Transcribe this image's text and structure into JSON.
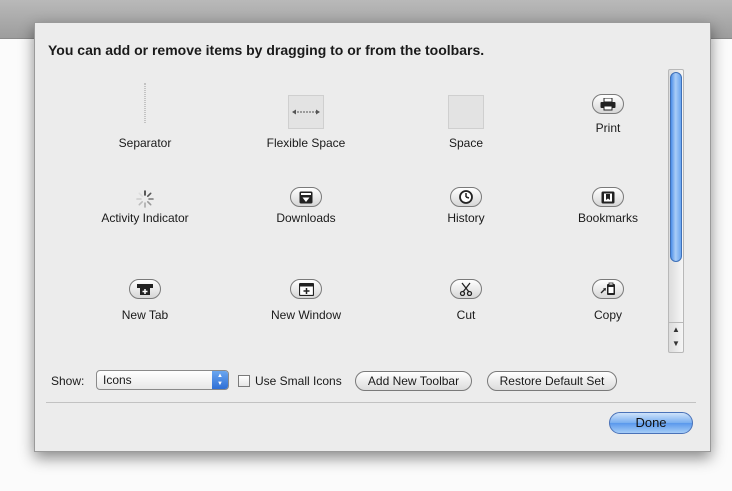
{
  "instruction": "You can add or remove items by dragging to or from the toolbars.",
  "items": [
    {
      "label": "Separator",
      "icon": "separator-icon"
    },
    {
      "label": "Flexible Space",
      "icon": "flexible-space-icon"
    },
    {
      "label": "Space",
      "icon": "space-icon"
    },
    {
      "label": "Print",
      "icon": "printer-icon"
    },
    {
      "label": "Activity Indicator",
      "icon": "activity-spinner-icon"
    },
    {
      "label": "Downloads",
      "icon": "downloads-icon"
    },
    {
      "label": "History",
      "icon": "clock-icon"
    },
    {
      "label": "Bookmarks",
      "icon": "bookmarks-icon"
    },
    {
      "label": "New Tab",
      "icon": "new-tab-icon"
    },
    {
      "label": "New Window",
      "icon": "new-window-icon"
    },
    {
      "label": "Cut",
      "icon": "scissors-icon"
    },
    {
      "label": "Copy",
      "icon": "copy-icon"
    }
  ],
  "controls": {
    "show_label": "Show:",
    "show_value": "Icons",
    "use_small_icons_label": "Use Small Icons",
    "use_small_icons_checked": false,
    "add_toolbar_label": "Add New Toolbar",
    "restore_label": "Restore Default Set",
    "done_label": "Done"
  },
  "colors": {
    "sheet_background": "#ececec",
    "scroll_thumb": "#4c8ee8",
    "done_button": "#78aef0"
  }
}
